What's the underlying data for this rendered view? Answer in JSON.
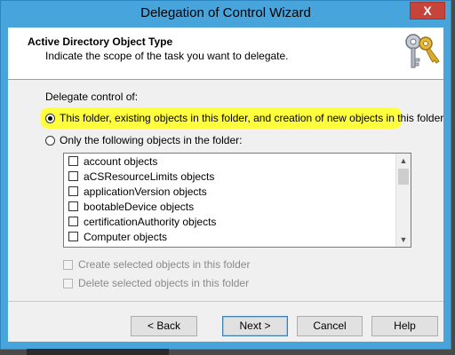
{
  "window": {
    "title": "Delegation of Control Wizard",
    "close_label": "X"
  },
  "header": {
    "title": "Active Directory Object Type",
    "subtitle": "Indicate the scope of the task you want to delegate."
  },
  "content": {
    "delegate_label": "Delegate control of:",
    "option_all": {
      "label": "This folder, existing objects in this folder, and creation of new objects in this folder",
      "checked": true
    },
    "option_only": {
      "label": "Only the following objects in the folder:",
      "checked": false
    },
    "objects": [
      "account objects",
      "aCSResourceLimits objects",
      "applicationVersion objects",
      "bootableDevice objects",
      "certificationAuthority objects",
      "Computer objects"
    ],
    "create_label": "Create selected objects in this folder",
    "delete_label": "Delete selected objects in this folder"
  },
  "buttons": {
    "back": "< Back",
    "next": "Next >",
    "cancel": "Cancel",
    "help": "Help"
  },
  "icons": {
    "wizard": "keys-icon",
    "scroll_up": "arrow-up-icon",
    "scroll_down": "arrow-down-icon"
  },
  "colors": {
    "title_bar": "#48a5dc",
    "highlight": "#ffff33",
    "close": "#c7443a"
  }
}
